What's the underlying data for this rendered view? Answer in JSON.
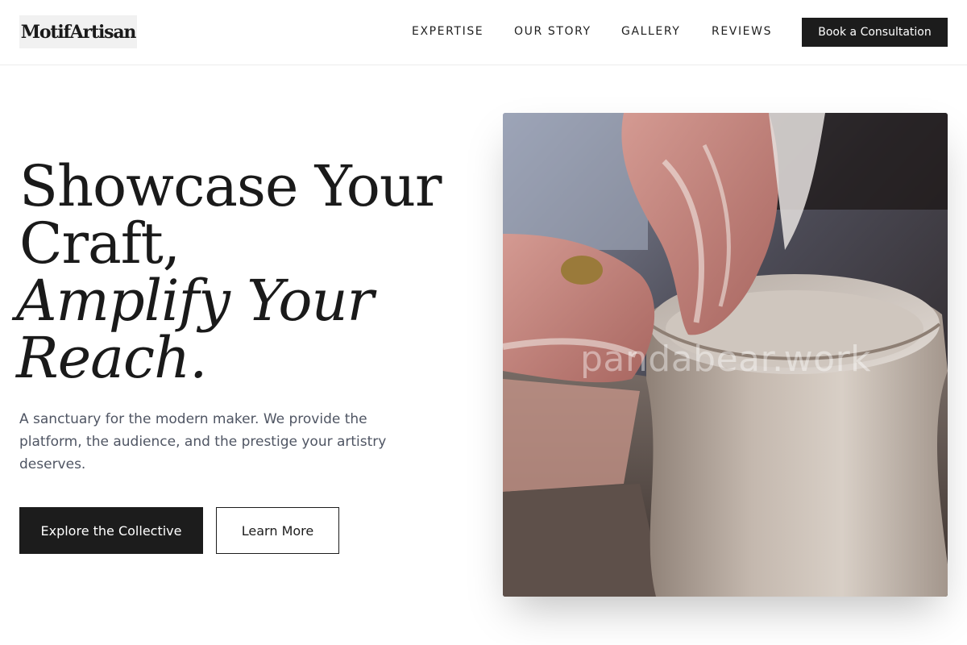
{
  "brand": {
    "logo_text": "MotifArtisan"
  },
  "nav": {
    "items": [
      {
        "label": "EXPERTISE"
      },
      {
        "label": "OUR STORY"
      },
      {
        "label": "GALLERY"
      },
      {
        "label": "REVIEWS"
      }
    ],
    "cta_label": "Book a Consultation"
  },
  "hero": {
    "headline_line1": "Showcase Your",
    "headline_line2": "Craft,",
    "headline_line3": "Amplify Your",
    "headline_line4": "Reach.",
    "lead": "A sanctuary for the modern maker. We provide the platform, the audience, and the prestige your artistry deserves.",
    "primary_button": "Explore the Collective",
    "secondary_button": "Learn More",
    "image_watermark": "pandabear.work"
  },
  "colors": {
    "ink": "#1a1a1a",
    "button_dark": "#1c1c1c",
    "body_text": "#4f5563",
    "logo_bg": "#f1f1f1"
  },
  "icons": {
    "hero_image": "pottery-wheel-hands-photo"
  }
}
